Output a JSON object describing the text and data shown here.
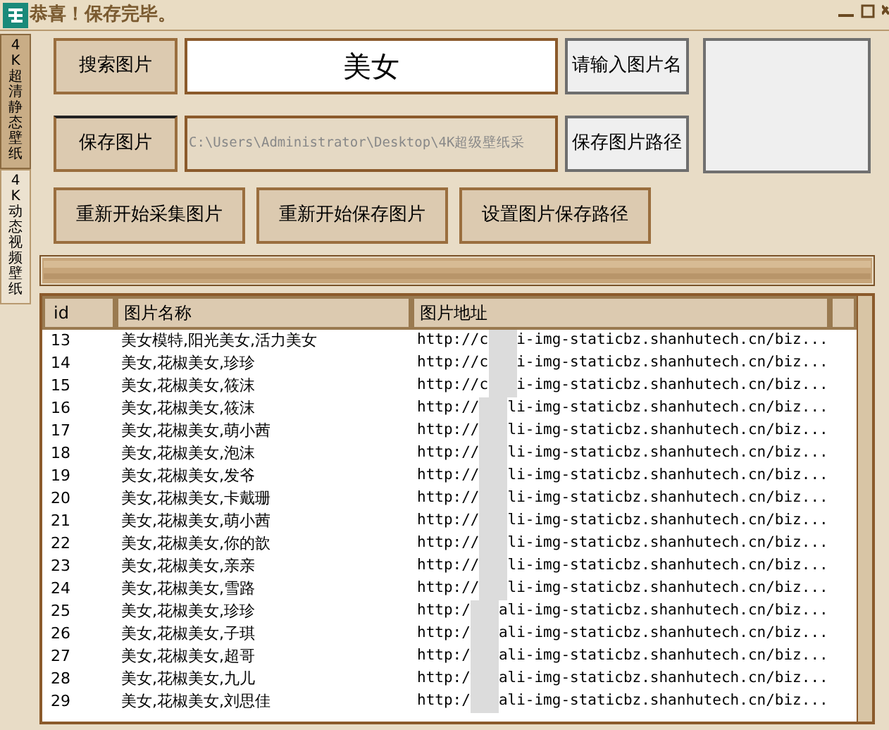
{
  "window": {
    "title": "恭喜！保存完毕。"
  },
  "tabs": [
    {
      "label": "4K超清静态壁纸",
      "selected": true
    },
    {
      "label": "4K动态视频壁纸",
      "selected": false
    }
  ],
  "search_button": "搜索图片",
  "search_field": {
    "value": "美女"
  },
  "name_hint": "请输入图片名",
  "save_button": "保存图片",
  "path_field": {
    "value": "C:\\Users\\Administrator\\Desktop\\4K超级壁纸采"
  },
  "path_hint": "保存图片路径",
  "action_buttons": [
    "重新开始采集图片",
    "重新开始保存图片",
    "设置图片保存路径"
  ],
  "progress": {
    "level": 1
  },
  "table": {
    "columns": [
      "id",
      "图片名称",
      "图片地址"
    ],
    "rows": [
      {
        "id": "13",
        "name": "美女模特,阳光美女,活力美女",
        "url_start": "http://c",
        "url_end": "i-img-staticbz.shanhutech.cn/biz..."
      },
      {
        "id": "14",
        "name": "美女,花椒美女,珍珍",
        "url_start": "http://c",
        "url_end": "i-img-staticbz.shanhutech.cn/biz..."
      },
      {
        "id": "15",
        "name": "美女,花椒美女,筱沫",
        "url_start": "http://c",
        "url_end": "i-img-staticbz.shanhutech.cn/biz..."
      },
      {
        "id": "16",
        "name": "美女,花椒美女,筱沫",
        "url_start": "http://",
        "url_end": "li-img-staticbz.shanhutech.cn/biz..."
      },
      {
        "id": "17",
        "name": "美女,花椒美女,萌小茜",
        "url_start": "http://",
        "url_end": "li-img-staticbz.shanhutech.cn/biz..."
      },
      {
        "id": "18",
        "name": "美女,花椒美女,泡沫",
        "url_start": "http://",
        "url_end": "li-img-staticbz.shanhutech.cn/biz..."
      },
      {
        "id": "19",
        "name": "美女,花椒美女,发爷",
        "url_start": "http://",
        "url_end": "li-img-staticbz.shanhutech.cn/biz..."
      },
      {
        "id": "20",
        "name": "美女,花椒美女,卡戴珊",
        "url_start": "http://",
        "url_end": "li-img-staticbz.shanhutech.cn/biz..."
      },
      {
        "id": "21",
        "name": "美女,花椒美女,萌小茜",
        "url_start": "http://",
        "url_end": "li-img-staticbz.shanhutech.cn/biz..."
      },
      {
        "id": "22",
        "name": "美女,花椒美女,你的歆",
        "url_start": "http://",
        "url_end": "li-img-staticbz.shanhutech.cn/biz..."
      },
      {
        "id": "23",
        "name": "美女,花椒美女,亲亲",
        "url_start": "http://",
        "url_end": "li-img-staticbz.shanhutech.cn/biz..."
      },
      {
        "id": "24",
        "name": "美女,花椒美女,雪路",
        "url_start": "http://",
        "url_end": "li-img-staticbz.shanhutech.cn/biz..."
      },
      {
        "id": "25",
        "name": "美女,花椒美女,珍珍",
        "url_start": "http:/",
        "url_end": "ali-img-staticbz.shanhutech.cn/biz..."
      },
      {
        "id": "26",
        "name": "美女,花椒美女,子琪",
        "url_start": "http:/",
        "url_end": "ali-img-staticbz.shanhutech.cn/biz..."
      },
      {
        "id": "27",
        "name": "美女,花椒美女,超哥",
        "url_start": "http:/",
        "url_end": "ali-img-staticbz.shanhutech.cn/biz..."
      },
      {
        "id": "28",
        "name": "美女,花椒美女,九儿",
        "url_start": "http:/",
        "url_end": "ali-img-staticbz.shanhutech.cn/biz..."
      },
      {
        "id": "29",
        "name": "美女,花椒美女,刘思佳",
        "url_start": "http:/",
        "url_end": "ali-img-staticbz.shanhutech.cn/biz..."
      }
    ]
  }
}
